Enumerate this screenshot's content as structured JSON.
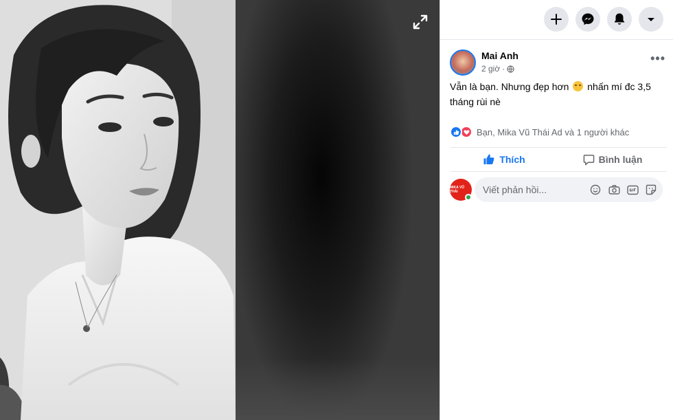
{
  "post": {
    "author": "Mai Anh",
    "time": "2 giờ",
    "time_separator": "·",
    "text_part1": "Vẫn là bạn. Nhưng đẹp hơn",
    "text_part2": "nhấn mí đc 3,5 tháng rùi nè",
    "more_label": "•••"
  },
  "reactions": {
    "summary": "Bạn, Mika Vũ Thái Ad và 1 người khác"
  },
  "actions": {
    "like_label": "Thích",
    "comment_label": "Bình luận"
  },
  "comment_input": {
    "placeholder": "Viết phản hồi..."
  },
  "my_avatar": {
    "mini_text": "MIKA VŨ THÁI"
  },
  "colors": {
    "accent": "#1877f2",
    "love": "#f33e58",
    "online": "#31a24c",
    "button_bg": "#e4e6eb"
  },
  "icons": {
    "expand": "expand-icon",
    "create": "plus-icon",
    "messenger": "messenger-icon",
    "notifications": "bell-icon",
    "account": "caret-down-icon",
    "audience": "globe-icon",
    "like": "thumbs-up-icon",
    "comment": "comment-icon",
    "emoji": "smiley-icon",
    "camera": "camera-icon",
    "gif": "gif-icon",
    "sticker": "sticker-icon"
  }
}
